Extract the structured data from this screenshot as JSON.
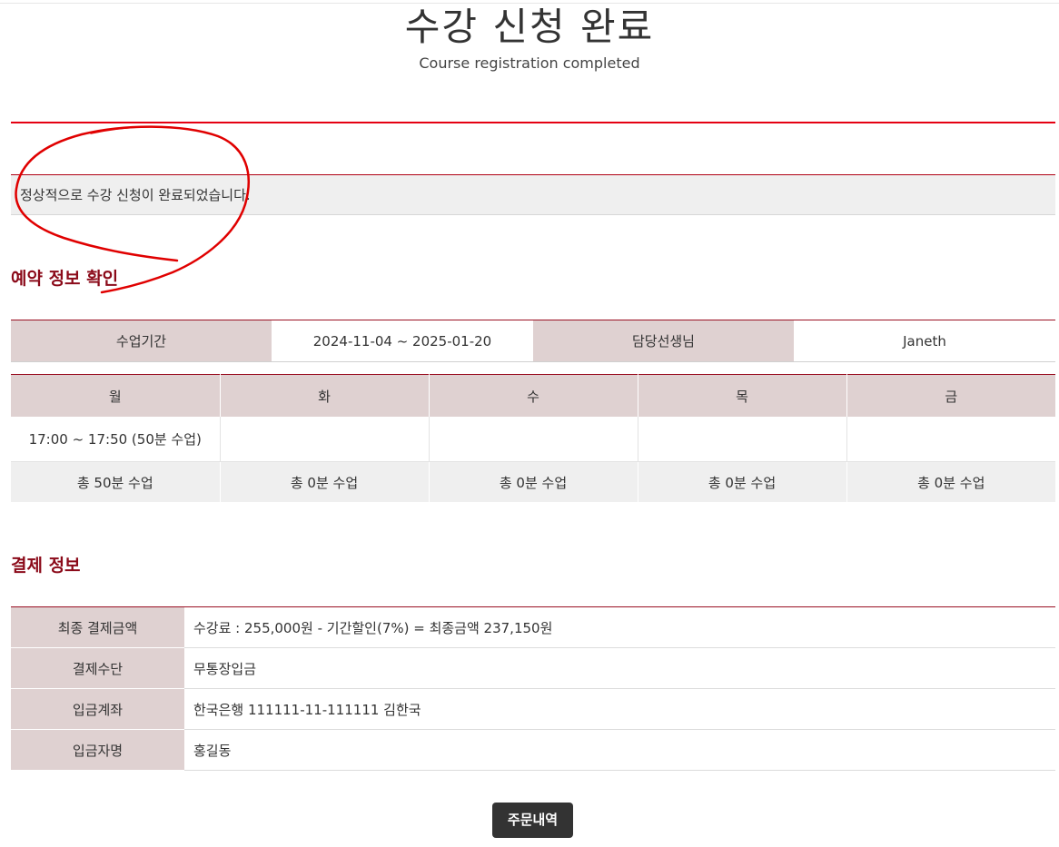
{
  "header": {
    "title": "수강 신청 완료",
    "subtitle": "Course registration completed"
  },
  "notice": {
    "message": "정상적으로 수강 신청이 완료되었습니다."
  },
  "reservation": {
    "section_title": "예약 정보 확인",
    "period_label": "수업기간",
    "period_value": "2024-11-04 ~ 2025-01-20",
    "teacher_label": "담당선생님",
    "teacher_value": "Janeth",
    "schedule": {
      "days": [
        "월",
        "화",
        "수",
        "목",
        "금"
      ],
      "times": [
        "17:00 ~ 17:50 (50분 수업)",
        "",
        "",
        "",
        ""
      ],
      "totals": [
        "총 50분 수업",
        "총 0분 수업",
        "총 0분 수업",
        "총 0분 수업",
        "총 0분 수업"
      ]
    }
  },
  "payment": {
    "section_title": "결제 정보",
    "rows": [
      {
        "label": "최종 결제금액",
        "value": "수강료 : 255,000원 - 기간할인(7%) = 최종금액 237,150원"
      },
      {
        "label": "결제수단",
        "value": "무통장입금"
      },
      {
        "label": "입금계좌",
        "value": "한국은행 111111-11-111111 김한국"
      },
      {
        "label": "입금자명",
        "value": "홍길동"
      }
    ]
  },
  "actions": {
    "order_history_label": "주문내역"
  },
  "colors": {
    "accent_red": "#e50012",
    "section_title": "#8b0a19",
    "label_bg": "#dfd1d1",
    "annotation_stroke": "#e00000"
  }
}
